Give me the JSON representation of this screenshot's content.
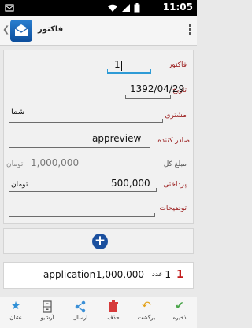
{
  "status_bar": {
    "time": "11:05",
    "icons": [
      "notification-icon",
      "wifi-icon",
      "signal-icon",
      "battery-icon"
    ]
  },
  "action_bar": {
    "title": "فاکتور",
    "back_glyph": "❮",
    "app_icon": "envelope-icon"
  },
  "form": {
    "invoice": {
      "label": "فاکتور",
      "value": "1"
    },
    "date": {
      "label": "تاریخ",
      "value": "1392/04/29"
    },
    "customer": {
      "label": "مشتری",
      "value": "شما"
    },
    "issuer": {
      "label": "صادر کننده",
      "value": "appreview"
    },
    "total": {
      "label": "مبلغ کل",
      "value": "1,000,000",
      "unit": "تومان"
    },
    "payment": {
      "label": "پرداختی",
      "value": "500,000",
      "unit": "تومان"
    },
    "description": {
      "label": "توضیحات",
      "value": ""
    }
  },
  "add_button": {
    "glyph": "+",
    "icon": "plus-circle-icon"
  },
  "items": [
    {
      "index": "1",
      "qty": "1",
      "unit": "عدد",
      "price": "1,000,000",
      "name": "application"
    }
  ],
  "toolbar": [
    {
      "name": "save",
      "label": "ذخیره",
      "icon": "check-icon",
      "glyph": "✔",
      "color": "#4ca64c"
    },
    {
      "name": "back",
      "label": "برگشت",
      "icon": "undo-icon",
      "glyph": "↶",
      "color": "#e3a21a"
    },
    {
      "name": "delete",
      "label": "حذف",
      "icon": "trash-icon",
      "glyph": "🗑",
      "color": "#d63a3a"
    },
    {
      "name": "send",
      "label": "ارسال",
      "icon": "share-icon",
      "glyph": "⋖",
      "color": "#3b8fd6"
    },
    {
      "name": "archive",
      "label": "آرشیو",
      "icon": "archive-icon",
      "glyph": "▤",
      "color": "#666666"
    },
    {
      "name": "bookmark",
      "label": "نشان",
      "icon": "star-icon",
      "glyph": "★",
      "color": "#2e8fd6"
    }
  ],
  "colors": {
    "label_red": "#9a1a1a",
    "focus_blue": "#2e9bd6",
    "add_button": "#1a4f9e",
    "index_red": "#c21b1b"
  }
}
